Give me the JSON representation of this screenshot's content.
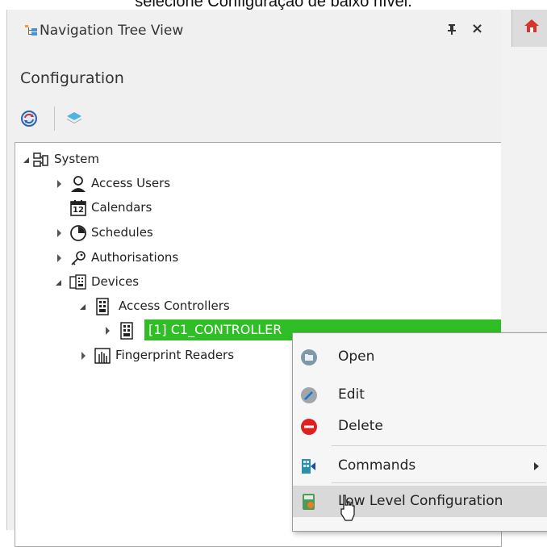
{
  "caption": "selecione Configuração de baixo nível.",
  "panel": {
    "title": "Navigation Tree View",
    "section_title": "Configuration",
    "pin_glyph": "↑",
    "close_glyph": "×"
  },
  "tree": {
    "system": "System",
    "access_users": "Access Users",
    "calendars": "Calendars",
    "calendar_day": "12",
    "schedules": "Schedules",
    "authorisations": "Authorisations",
    "devices": "Devices",
    "access_controllers": "Access Controllers",
    "controller": "[1] C1_CONTROLLER",
    "fingerprint_readers": "Fingerprint Readers"
  },
  "context_menu": {
    "open": "Open",
    "edit": "Edit",
    "delete": "Delete",
    "commands": "Commands",
    "low_level_configuration": "Low Level Configuration"
  },
  "colors": {
    "selection": "#2fbe26",
    "delete_red": "#e02020",
    "accent_blue": "#1a73c8"
  },
  "icons": [
    "tree-view-icon",
    "pin-icon",
    "close-icon",
    "refresh-icon",
    "layers-icon",
    "home-icon"
  ]
}
